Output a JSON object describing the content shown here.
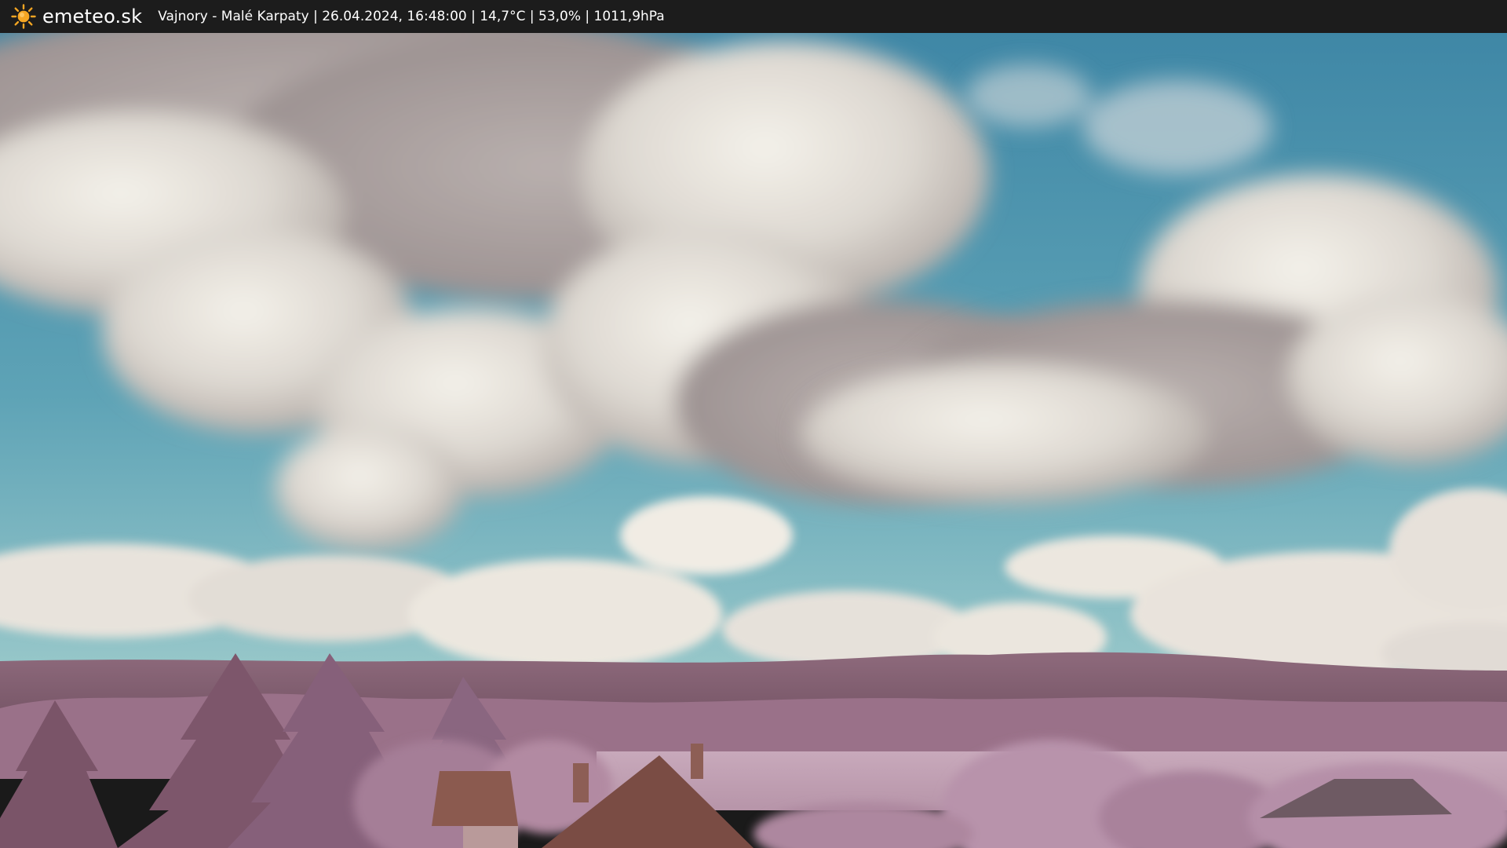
{
  "header": {
    "brand": "emeteo.sk",
    "logo_icon": "sun-icon",
    "caption": "Vajnory - Malé Karpaty | 26.04.2024, 16:48:00 | 14,7°C | 53,0% | 1011,9hPa"
  },
  "colors": {
    "bar_background": "#1c1c1c",
    "sun": "#f5a623",
    "sky_top": "#3f87a6",
    "sky_bottom": "#86c3c6",
    "hills": "#8e6a7c",
    "foliage": "#a27c95"
  }
}
